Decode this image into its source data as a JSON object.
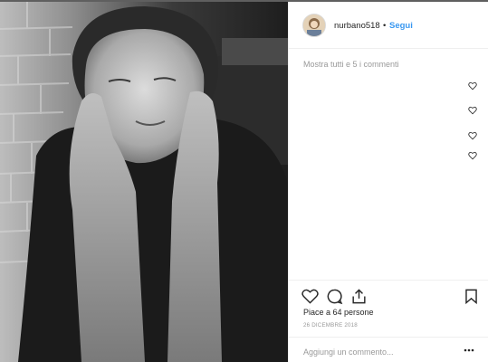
{
  "post": {
    "photo": {
      "alt_name": "black-and-white portrait photo"
    },
    "header": {
      "username": "nurbano518",
      "separator": "•",
      "follow_label": "Segui"
    },
    "comments": {
      "show_all_label": "Mostra tutti e 5 i commenti",
      "like_icons": [
        "heart-outline-icon",
        "heart-outline-icon",
        "heart-outline-icon",
        "heart-outline-icon"
      ]
    },
    "actions": {
      "icons": [
        "heart-icon",
        "comment-icon",
        "share-icon",
        "bookmark-icon"
      ]
    },
    "likes_label": "Piace a 64 persone",
    "date_label": "26 DICEMBRE 2018",
    "add_comment": {
      "placeholder": "Aggiungi un commento..."
    },
    "more_icon": "more-options-icon"
  }
}
